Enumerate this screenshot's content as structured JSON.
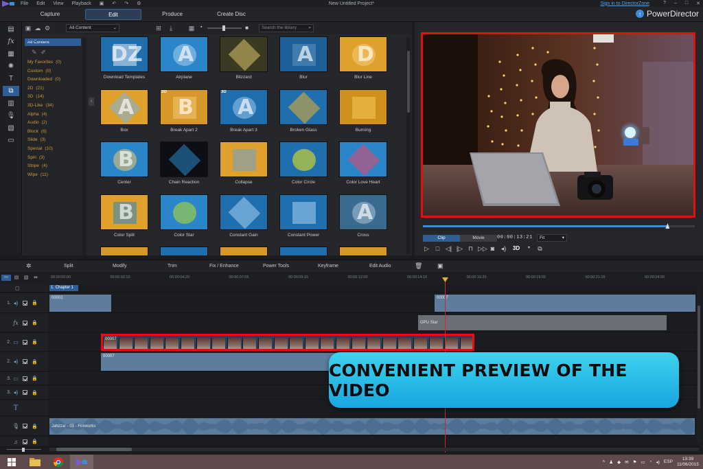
{
  "menu": {
    "items": [
      "File",
      "Edit",
      "View",
      "Playback"
    ],
    "window_title": "New Untitled Project*",
    "sign_in": "Sign in to DirectorZone",
    "window_controls": [
      "?",
      "–",
      "□",
      "✕"
    ]
  },
  "modes": {
    "tabs": [
      "Capture",
      "Edit",
      "Produce",
      "Create Disc"
    ],
    "active": "Edit",
    "brand": "PowerDirector"
  },
  "rooms": [
    "media-room-icon",
    "fx-room-icon",
    "pip-room-icon",
    "particle-room-icon",
    "title-room-icon",
    "transition-room-icon",
    "audio-mix-room-icon",
    "voiceover-room-icon",
    "chapter-room-icon",
    "subtitle-room-icon"
  ],
  "library": {
    "filter": "All Content",
    "search_placeholder": "Search the library",
    "categories_header": "All Content",
    "categories": [
      {
        "label": "My Favorites",
        "count": "(0)"
      },
      {
        "label": "Custom",
        "count": "(0)"
      },
      {
        "label": "Downloaded",
        "count": "(0)"
      },
      {
        "label": "2D",
        "count": "(21)"
      },
      {
        "label": "3D",
        "count": "(14)"
      },
      {
        "label": "3D-Like",
        "count": "(34)"
      },
      {
        "label": "Alpha",
        "count": "(4)"
      },
      {
        "label": "Audio",
        "count": "(2)"
      },
      {
        "label": "Block",
        "count": "(6)"
      },
      {
        "label": "Slide",
        "count": "(3)"
      },
      {
        "label": "Special",
        "count": "(10)"
      },
      {
        "label": "Spin",
        "count": "(3)"
      },
      {
        "label": "Stripe",
        "count": "(4)"
      },
      {
        "label": "Wipe",
        "count": "(11)"
      }
    ],
    "transitions": [
      {
        "label": "Download Templates",
        "letter": "DZ",
        "bg": "#1f6fae",
        "fg": "#dfeaf5",
        "tag": ""
      },
      {
        "label": "Airplane",
        "letter": "A",
        "bg": "#2a86c8",
        "fg": "#a8d0ee",
        "tag": ""
      },
      {
        "label": "Blizzard",
        "letter": "",
        "bg": "#3a3a22",
        "fg": "#d8c36a",
        "tag": ""
      },
      {
        "label": "Blur",
        "letter": "A",
        "bg": "#1d5f98",
        "fg": "#5b92c0",
        "tag": ""
      },
      {
        "label": "Blur Line",
        "letter": "D",
        "bg": "#e0a12c",
        "fg": "#f4cc7a",
        "tag": ""
      },
      {
        "label": "Box",
        "letter": "A",
        "bg": "#e0a12c",
        "fg": "#7fb4e2",
        "tag": ""
      },
      {
        "label": "Break Apart 2",
        "letter": "B",
        "bg": "#d6982a",
        "fg": "#f2c876",
        "tag": "3D"
      },
      {
        "label": "Break Apart 3",
        "letter": "A",
        "bg": "#1f6fae",
        "fg": "#9ac7ec",
        "tag": "3D"
      },
      {
        "label": "Broken Glass",
        "letter": "",
        "bg": "#1f6fae",
        "fg": "#e8b030",
        "tag": ""
      },
      {
        "label": "Burning",
        "letter": "",
        "bg": "#d0901e",
        "fg": "#f6c858",
        "tag": ""
      },
      {
        "label": "Center",
        "letter": "B",
        "bg": "#2a86c8",
        "fg": "#f2c86a",
        "tag": ""
      },
      {
        "label": "Chain Reaction",
        "letter": "",
        "bg": "#0d0f14",
        "fg": "#2a86c8",
        "tag": ""
      },
      {
        "label": "Collapse",
        "letter": "",
        "bg": "#e0a12c",
        "fg": "#6aa0d0",
        "tag": ""
      },
      {
        "label": "Color Circle",
        "letter": "",
        "bg": "#1f6fae",
        "fg": "#f4ea12",
        "tag": ""
      },
      {
        "label": "Color Love Heart",
        "letter": "",
        "bg": "#2a86c8",
        "fg": "#e8456c",
        "tag": ""
      },
      {
        "label": "Color Split",
        "letter": "B",
        "bg": "#e0a12c",
        "fg": "#2a86c8",
        "tag": ""
      },
      {
        "label": "Color Star",
        "letter": "",
        "bg": "#2a86c8",
        "fg": "#b6e02a",
        "tag": ""
      },
      {
        "label": "Constant Gain",
        "letter": "",
        "bg": "#1f6fae",
        "fg": "#a6d2f2",
        "tag": ""
      },
      {
        "label": "Constant Power",
        "letter": "",
        "bg": "#1f6fae",
        "fg": "#a6d2f2",
        "tag": ""
      },
      {
        "label": "Cross",
        "letter": "A",
        "bg": "#3a6a8e",
        "fg": "#a8c4d8",
        "tag": ""
      }
    ]
  },
  "preview": {
    "tabs": [
      "Clip",
      "Movie"
    ],
    "active_tab": "Clip",
    "timecode": "00:00:13:21",
    "fit": "Fit",
    "progress": 0.9,
    "mode_3d": "3D",
    "controls": [
      "play-icon",
      "stop-icon",
      "prev-frame-icon",
      "next-frame-icon",
      "split-icon",
      "fast-forward-icon",
      "snapshot-icon",
      "volume-icon",
      "3d-icon",
      "undock-icon"
    ]
  },
  "edit_toolbar": {
    "items": [
      "Split",
      "Modify",
      "Trim",
      "Fix / Enhance",
      "Power Tools",
      "Keyframe",
      "Edit Audio"
    ]
  },
  "timeline": {
    "ruler": [
      "00:00:00:00",
      "00:00:02:10",
      "00:00:04:20",
      "00:00:07:05",
      "00:00:09:15",
      "00:00:12:00",
      "00:00:14:10",
      "00:00:16:20",
      "00:00:19:05",
      "00:00:21:15",
      "00:00:24:00"
    ],
    "chapter": "1. Chapter 1",
    "tracks": [
      {
        "num": "1.",
        "type": "audio"
      },
      {
        "num": "",
        "type": "fx"
      },
      {
        "num": "2.",
        "type": "video"
      },
      {
        "num": "2.",
        "type": "audio"
      },
      {
        "num": "3.",
        "type": "video"
      },
      {
        "num": "3.",
        "type": "audio"
      },
      {
        "num": "",
        "type": "title"
      },
      {
        "num": "",
        "type": "voice"
      },
      {
        "num": "",
        "type": "music"
      }
    ],
    "clips": {
      "track1_a": "00002",
      "track1_b": "00007",
      "fx_clip": "GPU Star",
      "track2_video": "00007",
      "track2_audio": "00007",
      "music": "Jahzzar - 03 - Fireworks"
    }
  },
  "banner": {
    "text": "CONVENIENT PREVIEW OF THE VIDEO"
  },
  "taskbar": {
    "language": "ESP",
    "time": "13:39",
    "date": "11/06/2015"
  }
}
